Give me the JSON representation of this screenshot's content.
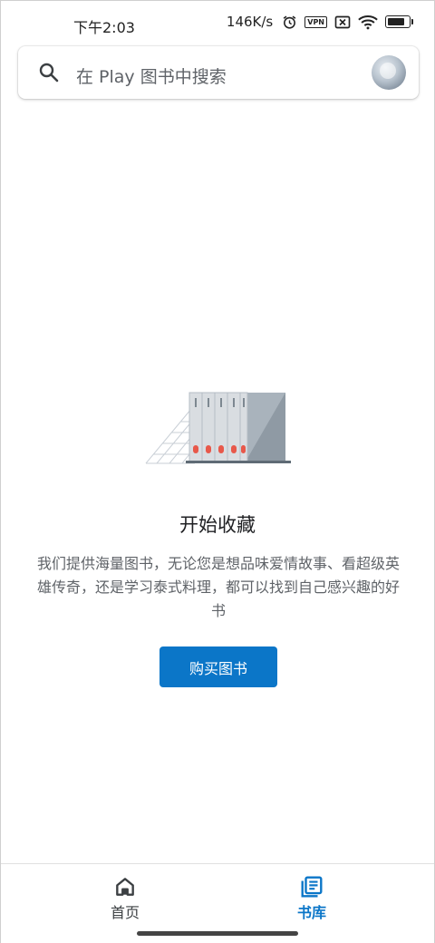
{
  "status_bar": {
    "time": "下午2:03",
    "net_speed": "146K/s",
    "icons": [
      "alarm-icon",
      "vpn-icon",
      "sim-off-icon",
      "wifi-icon",
      "battery-icon"
    ],
    "vpn_label": "VPN"
  },
  "search": {
    "placeholder": "在 Play 图书中搜索"
  },
  "empty_state": {
    "title": "开始收藏",
    "description": "我们提供海量图书，无论您是想品味爱情故事、看超级英雄传奇，还是学习泰式料理，都可以找到自己感兴趣的好书",
    "button_label": "购买图书"
  },
  "bottom_nav": {
    "items": [
      {
        "label": "首页",
        "icon": "home-icon",
        "selected": false
      },
      {
        "label": "书库",
        "icon": "library-icon",
        "selected": true
      }
    ]
  },
  "colors": {
    "accent": "#0b76c8",
    "text_primary": "#202124",
    "text_secondary": "#5f6368",
    "book_dot": "#e8584a"
  }
}
